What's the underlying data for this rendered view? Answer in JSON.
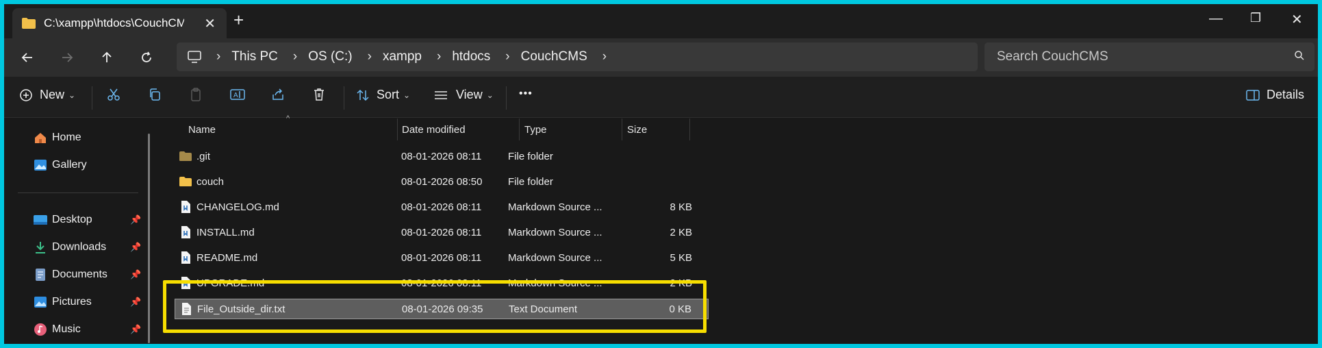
{
  "titlebar": {
    "tab_title": "C:\\xampp\\htdocs\\CouchCMS",
    "tab_close": "✕",
    "new_tab": "+",
    "minimize": "—",
    "restore": "❐",
    "close": "✕"
  },
  "navbar": {
    "breadcrumb": [
      "This PC",
      "OS (C:)",
      "xampp",
      "htdocs",
      "CouchCMS"
    ],
    "search_placeholder": "Search CouchCMS"
  },
  "toolbar": {
    "new_label": "New",
    "sort_label": "Sort",
    "view_label": "View",
    "more_label": "•••",
    "details_label": "Details"
  },
  "sidebar": {
    "items": [
      {
        "label": "Home",
        "icon": "home-icon"
      },
      {
        "label": "Gallery",
        "icon": "gallery-icon"
      },
      {
        "label": "Desktop",
        "icon": "desktop-icon",
        "pinned": true
      },
      {
        "label": "Downloads",
        "icon": "downloads-icon",
        "pinned": true
      },
      {
        "label": "Documents",
        "icon": "documents-icon",
        "pinned": true
      },
      {
        "label": "Pictures",
        "icon": "pictures-icon",
        "pinned": true
      },
      {
        "label": "Music",
        "icon": "music-icon",
        "pinned": true
      }
    ]
  },
  "filelist": {
    "columns": [
      "Name",
      "Date modified",
      "Type",
      "Size"
    ],
    "rows": [
      {
        "name": ".git",
        "date": "08-01-2026 08:11",
        "type": "File folder",
        "size": "",
        "icon": "folder-icon"
      },
      {
        "name": "couch",
        "date": "08-01-2026 08:50",
        "type": "File folder",
        "size": "",
        "icon": "folder-icon"
      },
      {
        "name": "CHANGELOG.md",
        "date": "08-01-2026 08:11",
        "type": "Markdown Source ...",
        "size": "8 KB",
        "icon": "markdown-file-icon"
      },
      {
        "name": "INSTALL.md",
        "date": "08-01-2026 08:11",
        "type": "Markdown Source ...",
        "size": "2 KB",
        "icon": "markdown-file-icon"
      },
      {
        "name": "README.md",
        "date": "08-01-2026 08:11",
        "type": "Markdown Source ...",
        "size": "5 KB",
        "icon": "markdown-file-icon"
      },
      {
        "name": "UPGRADE.md",
        "date": "08-01-2026 08:11",
        "type": "Markdown Source ...",
        "size": "2 KB",
        "icon": "markdown-file-icon"
      },
      {
        "name": "File_Outside_dir.txt",
        "date": "08-01-2026 09:35",
        "type": "Text Document",
        "size": "0 KB",
        "icon": "text-file-icon",
        "selected": true
      }
    ]
  },
  "colors": {
    "highlight_box": "#f7de00",
    "background_frame": "#00c8e0",
    "folder": "#e8b84a"
  }
}
